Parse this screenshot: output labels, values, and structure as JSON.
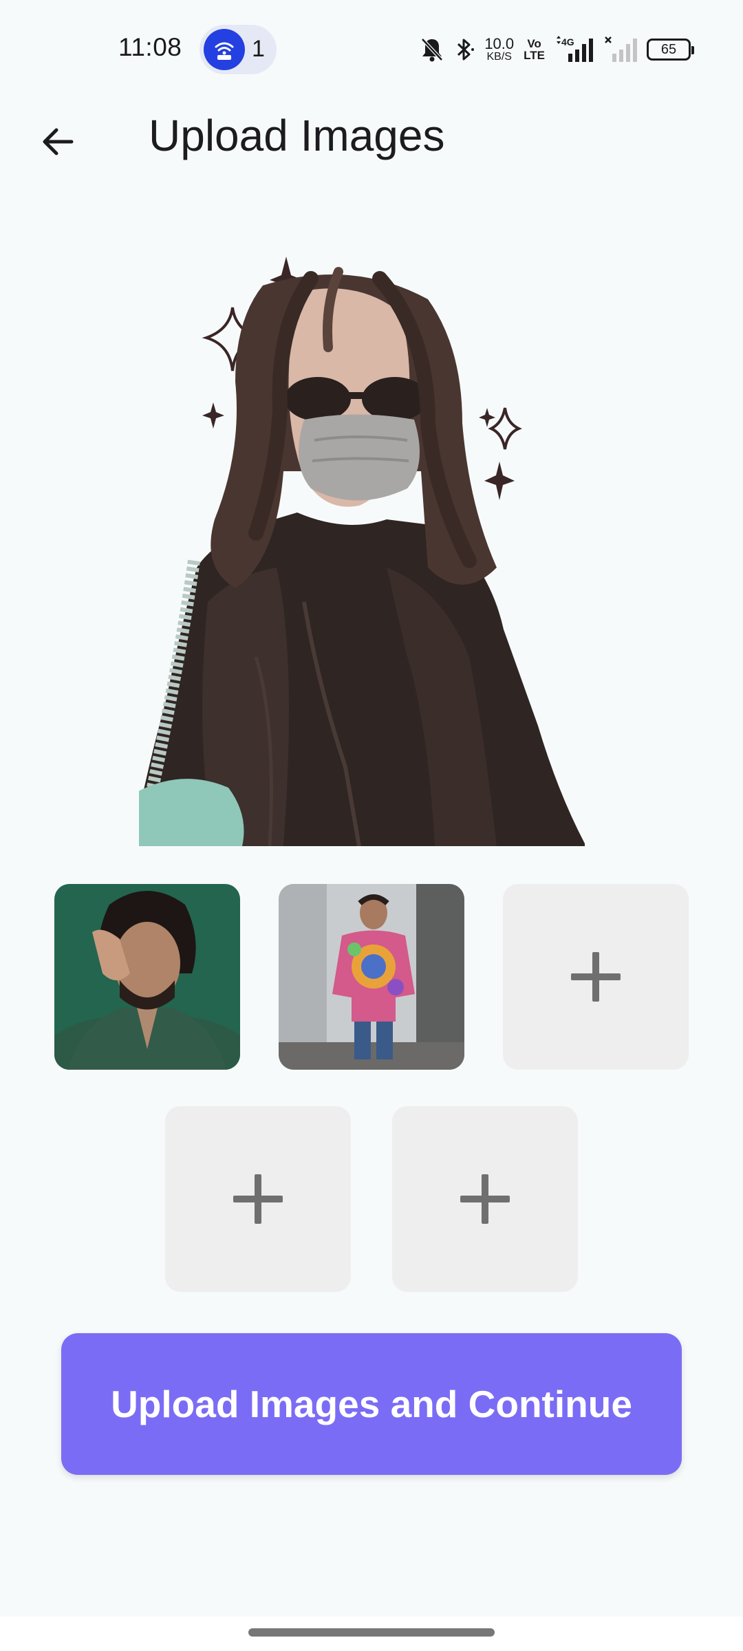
{
  "status_bar": {
    "time": "11:08",
    "hotspot_count": "1",
    "net_speed_value": "10.0",
    "net_speed_unit": "KB/S",
    "volte_top": "Vo",
    "volte_bottom": "LTE",
    "network_type": "4G",
    "battery_level": "65"
  },
  "header": {
    "title": "Upload Images",
    "back_icon": "arrow-back-icon"
  },
  "upload_slots": [
    {
      "state": "filled",
      "content": "photo-man-green-shirt"
    },
    {
      "state": "filled",
      "content": "photo-man-tie-dye-shirt"
    },
    {
      "state": "empty",
      "icon": "plus-icon"
    },
    {
      "state": "empty",
      "icon": "plus-icon"
    },
    {
      "state": "empty",
      "icon": "plus-icon"
    }
  ],
  "cta": {
    "label": "Upload Images and Continue"
  },
  "colors": {
    "background": "#f7fafb",
    "accent": "#7b6cf6",
    "slot_empty": "#eeeeee",
    "hotspot": "#2440e0"
  }
}
